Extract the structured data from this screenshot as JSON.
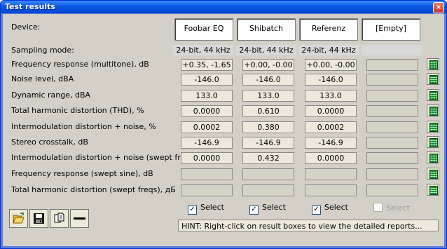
{
  "window": {
    "title": "Test results",
    "close_glyph": "×"
  },
  "device_label": "Device:",
  "devices": [
    "Foobar EQ",
    "Shibatch",
    "Referenz",
    "[Empty]"
  ],
  "sampling": {
    "label": "Sampling mode:",
    "values": [
      "24-bit, 44 kHz",
      "24-bit, 44 kHz",
      "24-bit, 44 kHz",
      ""
    ]
  },
  "rows": [
    {
      "label": "Frequency response (multitone), dB",
      "values": [
        "+0.35, -1.65",
        "+0.00, -0.00",
        "+0.00, -0.00",
        ""
      ]
    },
    {
      "label": "Noise level, dBA",
      "values": [
        "-146.0",
        "-146.0",
        "-146.0",
        ""
      ]
    },
    {
      "label": "Dynamic range, dBA",
      "values": [
        "133.0",
        "133.0",
        "133.0",
        ""
      ]
    },
    {
      "label": "Total harmonic distortion (THD), %",
      "values": [
        "0.0000",
        "0.610",
        "0.0000",
        ""
      ]
    },
    {
      "label": "Intermodulation distortion + noise, %",
      "values": [
        "0.0002",
        "0.380",
        "0.0002",
        ""
      ]
    },
    {
      "label": "Stereo crosstalk, dB",
      "values": [
        "-146.9",
        "-146.9",
        "-146.9",
        ""
      ]
    },
    {
      "label": "Intermodulation distortion + noise (swept freqs), %",
      "values": [
        "0.0000",
        "0.432",
        "0.0000",
        ""
      ]
    },
    {
      "label": "Frequency response (swept sine), dB",
      "values": [
        "",
        "",
        "",
        ""
      ]
    },
    {
      "label": "Total harmonic distortion (swept freqs), дБ",
      "values": [
        "",
        "",
        "",
        ""
      ]
    }
  ],
  "selects": [
    {
      "label": "Select",
      "checked": true,
      "enabled": true
    },
    {
      "label": "Select",
      "checked": true,
      "enabled": true
    },
    {
      "label": "Select",
      "checked": true,
      "enabled": true
    },
    {
      "label": "Select",
      "checked": false,
      "enabled": false
    }
  ],
  "hint": "HINT: Right-click on result boxes to view the detailed reports...",
  "toolbar": {
    "icons": [
      "open-folder-icon",
      "save-icon",
      "copy-pages-icon",
      "line-icon"
    ]
  },
  "colors": {
    "title_bar": "#0a58e0",
    "panel": "#d4d0c8",
    "value_box": "#ede8db",
    "graph_icon": "#0a7a2a"
  }
}
